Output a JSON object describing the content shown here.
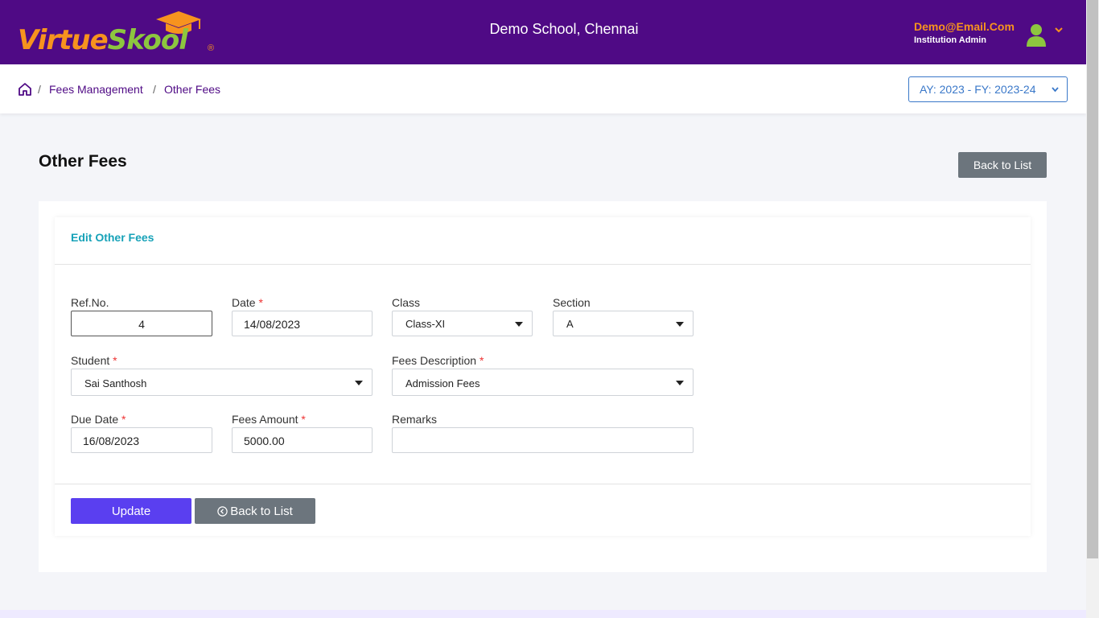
{
  "header": {
    "logo_part1": "Virtue",
    "logo_part2": "Skool",
    "logo_reg": "®",
    "school_name": "Demo School, Chennai",
    "user_email": "Demo@Email.Com",
    "user_role": "Institution Admin"
  },
  "breadcrumb": {
    "items": [
      "Fees Management",
      "Other Fees"
    ],
    "separator": "/"
  },
  "academic_year": "AY: 2023 - FY: 2023-24",
  "page": {
    "title": "Other Fees",
    "back_to_list": "Back to List"
  },
  "form": {
    "card_title": "Edit Other Fees",
    "ref_no": {
      "label": "Ref.No.",
      "value": "4"
    },
    "date": {
      "label": "Date",
      "value": "14/08/2023"
    },
    "class": {
      "label": "Class",
      "value": "Class-XI"
    },
    "section": {
      "label": "Section",
      "value": "A"
    },
    "student": {
      "label": "Student",
      "value": "Sai Santhosh"
    },
    "fees_description": {
      "label": "Fees Description",
      "value": "Admission Fees"
    },
    "due_date": {
      "label": "Due Date",
      "value": "16/08/2023"
    },
    "fees_amount": {
      "label": "Fees Amount",
      "value": "5000.00"
    },
    "remarks": {
      "label": "Remarks",
      "value": ""
    },
    "required_mark": "*",
    "update_label": "Update",
    "back_label": "Back to List"
  },
  "colors": {
    "header_bg": "#4f0a85",
    "brand_orange": "#f7931e",
    "brand_green": "#8dc63f",
    "accent_teal": "#17a2b8",
    "update_button": "#5a3ff0",
    "secondary_button": "#6c757d"
  }
}
